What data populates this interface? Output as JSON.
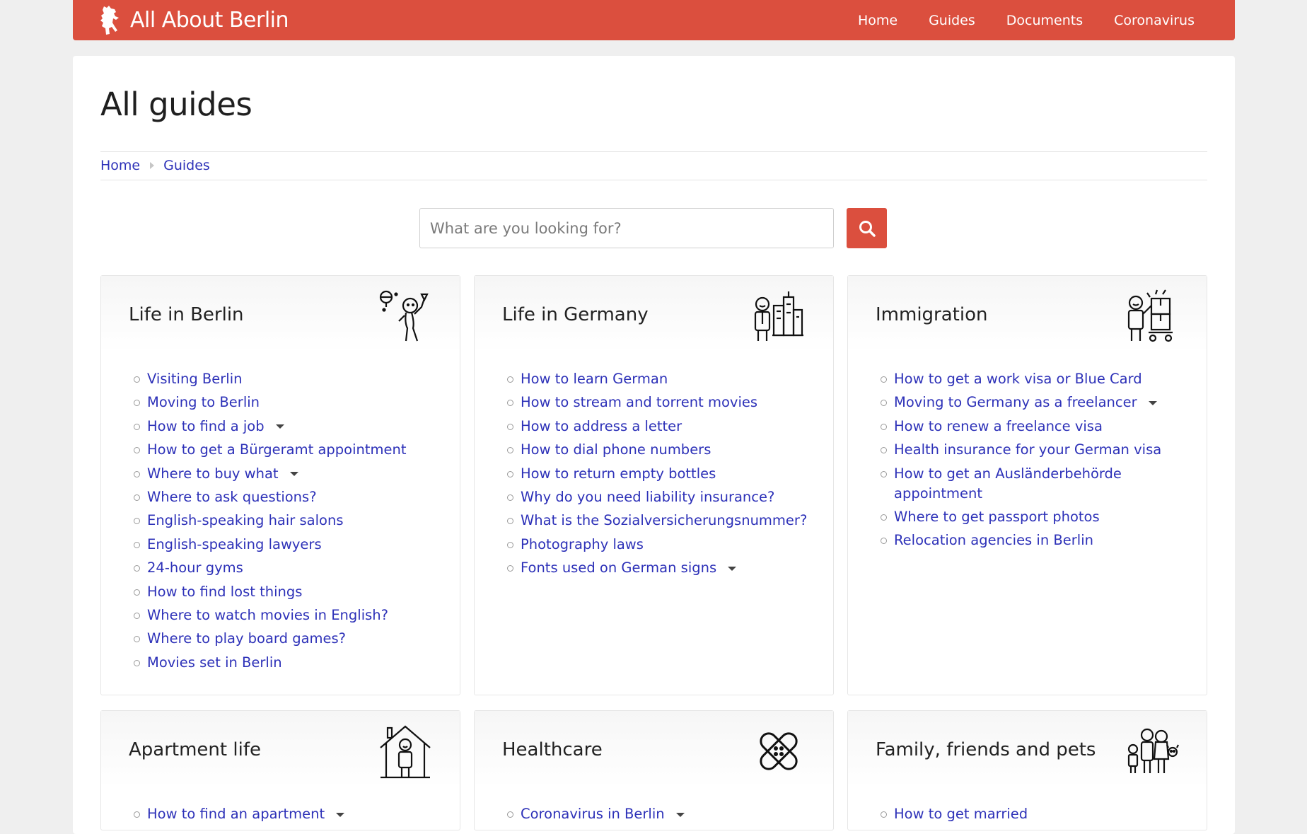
{
  "header": {
    "brand": "All About Berlin",
    "nav": [
      "Home",
      "Guides",
      "Documents",
      "Coronavirus"
    ]
  },
  "page": {
    "title": "All guides",
    "breadcrumb": [
      "Home",
      "Guides"
    ]
  },
  "search": {
    "placeholder": "What are you looking for?"
  },
  "colors": {
    "accent": "#db4f3e",
    "link": "#2d31b8"
  },
  "cards": [
    {
      "title": "Life in Berlin",
      "icon": "person-with-bottle-icon",
      "items": [
        {
          "label": "Visiting Berlin",
          "expandable": false
        },
        {
          "label": "Moving to Berlin",
          "expandable": false
        },
        {
          "label": "How to find a job",
          "expandable": true
        },
        {
          "label": "How to get a Bürgeramt appointment",
          "expandable": false
        },
        {
          "label": "Where to buy what",
          "expandable": true
        },
        {
          "label": "Where to ask questions?",
          "expandable": false
        },
        {
          "label": "English-speaking hair salons",
          "expandable": false
        },
        {
          "label": "English-speaking lawyers",
          "expandable": false
        },
        {
          "label": "24-hour gyms",
          "expandable": false
        },
        {
          "label": "How to find lost things",
          "expandable": false
        },
        {
          "label": "Where to watch movies in English?",
          "expandable": false
        },
        {
          "label": "Where to play board games?",
          "expandable": false
        },
        {
          "label": "Movies set in Berlin",
          "expandable": false
        }
      ]
    },
    {
      "title": "Life in Germany",
      "icon": "person-city-icon",
      "items": [
        {
          "label": "How to learn German",
          "expandable": false
        },
        {
          "label": "How to stream and torrent movies",
          "expandable": false
        },
        {
          "label": "How to address a letter",
          "expandable": false
        },
        {
          "label": "How to dial phone numbers",
          "expandable": false
        },
        {
          "label": "How to return empty bottles",
          "expandable": false
        },
        {
          "label": "Why do you need liability insurance?",
          "expandable": false
        },
        {
          "label": "What is the Sozialversicherungsnummer?",
          "expandable": false
        },
        {
          "label": "Photography laws",
          "expandable": false
        },
        {
          "label": "Fonts used on German signs",
          "expandable": true
        }
      ]
    },
    {
      "title": "Immigration",
      "icon": "person-moving-boxes-icon",
      "items": [
        {
          "label": "How to get a work visa or Blue Card",
          "expandable": false
        },
        {
          "label": "Moving to Germany as a freelancer",
          "expandable": true
        },
        {
          "label": "How to renew a freelance visa",
          "expandable": false
        },
        {
          "label": "Health insurance for your German visa",
          "expandable": false
        },
        {
          "label": "How to get an Ausländerbehörde appointment",
          "expandable": false
        },
        {
          "label": "Where to get passport photos",
          "expandable": false
        },
        {
          "label": "Relocation agencies in Berlin",
          "expandable": false
        }
      ]
    },
    {
      "title": "Apartment life",
      "icon": "person-house-icon",
      "items": [
        {
          "label": "How to find an apartment",
          "expandable": true
        }
      ]
    },
    {
      "title": "Healthcare",
      "icon": "bandage-icon",
      "items": [
        {
          "label": "Coronavirus in Berlin",
          "expandable": true
        }
      ]
    },
    {
      "title": "Family, friends and pets",
      "icon": "family-icon",
      "items": [
        {
          "label": "How to get married",
          "expandable": false
        }
      ]
    }
  ]
}
